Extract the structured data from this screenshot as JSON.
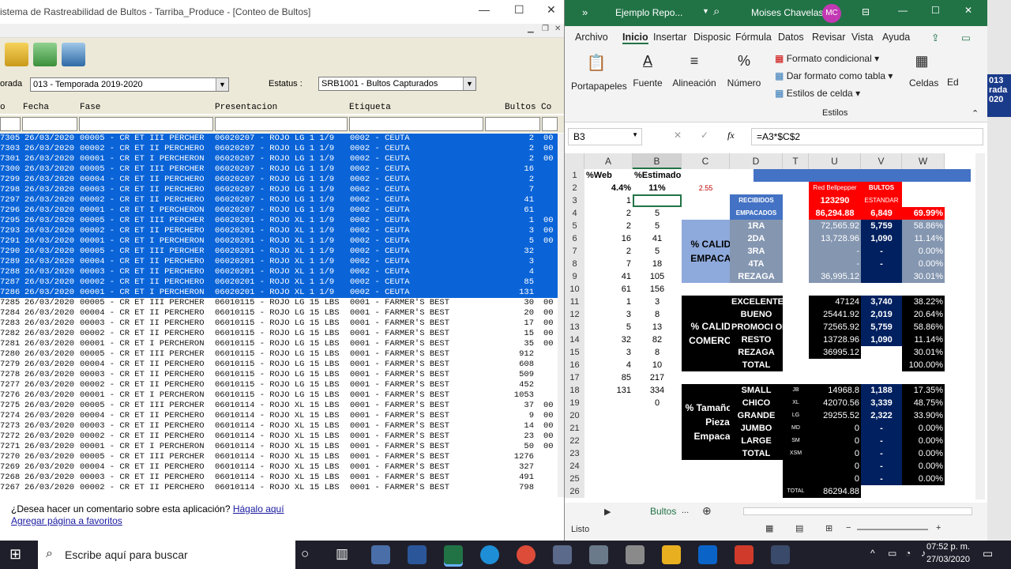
{
  "left_window": {
    "title": "istema de Rastreabilidad de Bultos - Tarriba_Produce - [Conteo de Bultos]",
    "temporada_label": "orada",
    "temporada_value": "013 - Temporada 2019-2020",
    "estatus_label": "Estatus :",
    "estatus_value": "SRB1001 - Bultos Capturados",
    "columns": [
      "o",
      "Fecha",
      "Fase",
      "Presentacion",
      "Etiqueta",
      "Bultos",
      "Co"
    ],
    "rows": [
      {
        "id": "7305",
        "date": "26/03/2020",
        "fase": "00005 - CR ET III PERCHER",
        "pres": "06020207 - ROJO LG 1 1/9",
        "etq": "0002 - CEUTA",
        "b": "2",
        "co": "00",
        "sel": true
      },
      {
        "id": "7303",
        "date": "26/03/2020",
        "fase": "00002 - CR ET II PERCHERO",
        "pres": "06020207 - ROJO LG 1 1/9",
        "etq": "0002 - CEUTA",
        "b": "2",
        "co": "00",
        "sel": true
      },
      {
        "id": "7301",
        "date": "26/03/2020",
        "fase": "00001 - CR ET I PERCHERON",
        "pres": "06020207 - ROJO LG 1 1/9",
        "etq": "0002 - CEUTA",
        "b": "2",
        "co": "00",
        "sel": true
      },
      {
        "id": "7300",
        "date": "26/03/2020",
        "fase": "00005 - CR ET III PERCHER",
        "pres": "06020207 - ROJO LG 1 1/9",
        "etq": "0002 - CEUTA",
        "b": "16",
        "co": "",
        "sel": true
      },
      {
        "id": "7299",
        "date": "26/03/2020",
        "fase": "00004 - CR ET II PERCHERO",
        "pres": "06020207 - ROJO LG 1 1/9",
        "etq": "0002 - CEUTA",
        "b": "2",
        "co": "",
        "sel": true
      },
      {
        "id": "7298",
        "date": "26/03/2020",
        "fase": "00003 - CR ET II PERCHERO",
        "pres": "06020207 - ROJO LG 1 1/9",
        "etq": "0002 - CEUTA",
        "b": "7",
        "co": "",
        "sel": true
      },
      {
        "id": "7297",
        "date": "26/03/2020",
        "fase": "00002 - CR ET II PERCHERO",
        "pres": "06020207 - ROJO LG 1 1/9",
        "etq": "0002 - CEUTA",
        "b": "41",
        "co": "",
        "sel": true
      },
      {
        "id": "7296",
        "date": "26/03/2020",
        "fase": "00001 - CR ET I PERCHERON",
        "pres": "06020207 - ROJO LG 1 1/9",
        "etq": "0002 - CEUTA",
        "b": "61",
        "co": "",
        "sel": true
      },
      {
        "id": "7295",
        "date": "26/03/2020",
        "fase": "00005 - CR ET III PERCHER",
        "pres": "06020201 - ROJO XL 1 1/9",
        "etq": "0002 - CEUTA",
        "b": "1",
        "co": "00",
        "sel": true
      },
      {
        "id": "7293",
        "date": "26/03/2020",
        "fase": "00002 - CR ET II PERCHERO",
        "pres": "06020201 - ROJO XL 1 1/9",
        "etq": "0002 - CEUTA",
        "b": "3",
        "co": "00",
        "sel": true
      },
      {
        "id": "7291",
        "date": "26/03/2020",
        "fase": "00001 - CR ET I PERCHERON",
        "pres": "06020201 - ROJO XL 1 1/9",
        "etq": "0002 - CEUTA",
        "b": "5",
        "co": "00",
        "sel": true
      },
      {
        "id": "7290",
        "date": "26/03/2020",
        "fase": "00005 - CR ET III PERCHER",
        "pres": "06020201 - ROJO XL 1 1/9",
        "etq": "0002 - CEUTA",
        "b": "32",
        "co": "",
        "sel": true
      },
      {
        "id": "7289",
        "date": "26/03/2020",
        "fase": "00004 - CR ET II PERCHERO",
        "pres": "06020201 - ROJO XL 1 1/9",
        "etq": "0002 - CEUTA",
        "b": "3",
        "co": "",
        "sel": true
      },
      {
        "id": "7288",
        "date": "26/03/2020",
        "fase": "00003 - CR ET II PERCHERO",
        "pres": "06020201 - ROJO XL 1 1/9",
        "etq": "0002 - CEUTA",
        "b": "4",
        "co": "",
        "sel": true
      },
      {
        "id": "7287",
        "date": "26/03/2020",
        "fase": "00002 - CR ET II PERCHERO",
        "pres": "06020201 - ROJO XL 1 1/9",
        "etq": "0002 - CEUTA",
        "b": "85",
        "co": "",
        "sel": true
      },
      {
        "id": "7286",
        "date": "26/03/2020",
        "fase": "00001 - CR ET I PERCHERON",
        "pres": "06020201 - ROJO XL 1 1/9",
        "etq": "0002 - CEUTA",
        "b": "131",
        "co": "",
        "sel": true
      },
      {
        "id": "7285",
        "date": "26/03/2020",
        "fase": "00005 - CR ET III PERCHER",
        "pres": "06010115 - ROJO LG 15 LBS",
        "etq": "0001 - FARMER'S BEST",
        "b": "30",
        "co": "00",
        "sel": false
      },
      {
        "id": "7284",
        "date": "26/03/2020",
        "fase": "00004 - CR ET II PERCHERO",
        "pres": "06010115 - ROJO LG 15 LBS",
        "etq": "0001 - FARMER'S BEST",
        "b": "20",
        "co": "00",
        "sel": false
      },
      {
        "id": "7283",
        "date": "26/03/2020",
        "fase": "00003 - CR ET II PERCHERO",
        "pres": "06010115 - ROJO LG 15 LBS",
        "etq": "0001 - FARMER'S BEST",
        "b": "17",
        "co": "00",
        "sel": false
      },
      {
        "id": "7282",
        "date": "26/03/2020",
        "fase": "00002 - CR ET II PERCHERO",
        "pres": "06010115 - ROJO LG 15 LBS",
        "etq": "0001 - FARMER'S BEST",
        "b": "15",
        "co": "00",
        "sel": false
      },
      {
        "id": "7281",
        "date": "26/03/2020",
        "fase": "00001 - CR ET I PERCHERON",
        "pres": "06010115 - ROJO LG 15 LBS",
        "etq": "0001 - FARMER'S BEST",
        "b": "35",
        "co": "00",
        "sel": false
      },
      {
        "id": "7280",
        "date": "26/03/2020",
        "fase": "00005 - CR ET III PERCHER",
        "pres": "06010115 - ROJO LG 15 LBS",
        "etq": "0001 - FARMER'S BEST",
        "b": "912",
        "co": "",
        "sel": false
      },
      {
        "id": "7279",
        "date": "26/03/2020",
        "fase": "00004 - CR ET II PERCHERO",
        "pres": "06010115 - ROJO LG 15 LBS",
        "etq": "0001 - FARMER'S BEST",
        "b": "608",
        "co": "",
        "sel": false
      },
      {
        "id": "7278",
        "date": "26/03/2020",
        "fase": "00003 - CR ET II PERCHERO",
        "pres": "06010115 - ROJO LG 15 LBS",
        "etq": "0001 - FARMER'S BEST",
        "b": "509",
        "co": "",
        "sel": false
      },
      {
        "id": "7277",
        "date": "26/03/2020",
        "fase": "00002 - CR ET II PERCHERO",
        "pres": "06010115 - ROJO LG 15 LBS",
        "etq": "0001 - FARMER'S BEST",
        "b": "452",
        "co": "",
        "sel": false
      },
      {
        "id": "7276",
        "date": "26/03/2020",
        "fase": "00001 - CR ET I PERCHERON",
        "pres": "06010115 - ROJO LG 15 LBS",
        "etq": "0001 - FARMER'S BEST",
        "b": "1053",
        "co": "",
        "sel": false
      },
      {
        "id": "7275",
        "date": "26/03/2020",
        "fase": "00005 - CR ET III PERCHER",
        "pres": "06010114 - ROJO XL 15 LBS",
        "etq": "0001 - FARMER'S BEST",
        "b": "37",
        "co": "00",
        "sel": false
      },
      {
        "id": "7274",
        "date": "26/03/2020",
        "fase": "00004 - CR ET II PERCHERO",
        "pres": "06010114 - ROJO XL 15 LBS",
        "etq": "0001 - FARMER'S BEST",
        "b": "9",
        "co": "00",
        "sel": false
      },
      {
        "id": "7273",
        "date": "26/03/2020",
        "fase": "00003 - CR ET II PERCHERO",
        "pres": "06010114 - ROJO XL 15 LBS",
        "etq": "0001 - FARMER'S BEST",
        "b": "14",
        "co": "00",
        "sel": false
      },
      {
        "id": "7272",
        "date": "26/03/2020",
        "fase": "00002 - CR ET II PERCHERO",
        "pres": "06010114 - ROJO XL 15 LBS",
        "etq": "0001 - FARMER'S BEST",
        "b": "23",
        "co": "00",
        "sel": false
      },
      {
        "id": "7271",
        "date": "26/03/2020",
        "fase": "00001 - CR ET I PERCHERON",
        "pres": "06010114 - ROJO XL 15 LBS",
        "etq": "0001 - FARMER'S BEST",
        "b": "50",
        "co": "00",
        "sel": false
      },
      {
        "id": "7270",
        "date": "26/03/2020",
        "fase": "00005 - CR ET III PERCHER",
        "pres": "06010114 - ROJO XL 15 LBS",
        "etq": "0001 - FARMER'S BEST",
        "b": "1276",
        "co": "",
        "sel": false
      },
      {
        "id": "7269",
        "date": "26/03/2020",
        "fase": "00004 - CR ET II PERCHERO",
        "pres": "06010114 - ROJO XL 15 LBS",
        "etq": "0001 - FARMER'S BEST",
        "b": "327",
        "co": "",
        "sel": false
      },
      {
        "id": "7268",
        "date": "26/03/2020",
        "fase": "00003 - CR ET II PERCHERO",
        "pres": "06010114 - ROJO XL 15 LBS",
        "etq": "0001 - FARMER'S BEST",
        "b": "491",
        "co": "",
        "sel": false
      },
      {
        "id": "7267",
        "date": "26/03/2020",
        "fase": "00002 - CR ET II PERCHERO",
        "pres": "06010114 - ROJO XL 15 LBS",
        "etq": "0001 - FARMER'S BEST",
        "b": "798",
        "co": "",
        "sel": false
      }
    ],
    "footer_text": "¿Desea hacer un comentario sobre esta aplicación?",
    "footer_link": "Hágalo aquí",
    "footer_fav": "Agregar página a favoritos"
  },
  "excel": {
    "file_name": "Ejemplo Repo...",
    "user_name": "Moises Chavelas",
    "user_initials": "MC",
    "tabs": [
      "Archivo",
      "Inicio",
      "Insertar",
      "Disposic",
      "Fórmula",
      "Datos",
      "Revisar",
      "Vista",
      "Ayuda"
    ],
    "ribbon": {
      "portapapeles": "Portapapeles",
      "fuente": "Fuente",
      "alineacion": "Alineación",
      "numero": "Número",
      "formato_condicional": "Formato condicional",
      "dar_formato": "Dar formato como tabla",
      "estilos_celda": "Estilos de celda",
      "estilos": "Estilos",
      "celdas": "Celdas",
      "ed": "Ed"
    },
    "name_box": "B3",
    "formula": "=A3*$C$2",
    "col_headers": [
      "A",
      "B",
      "C",
      "D",
      "T",
      "U",
      "V",
      "W"
    ],
    "row_numbers": [
      "1",
      "2",
      "3",
      "4",
      "5",
      "6",
      "7",
      "8",
      "9",
      "10",
      "11",
      "12",
      "13",
      "14",
      "15",
      "16",
      "17",
      "18",
      "19",
      "20",
      "21",
      "22",
      "23",
      "24",
      "25",
      "26"
    ],
    "colA": [
      "%Web",
      "4.4%",
      "1",
      "2",
      "2",
      "16",
      "2",
      "7",
      "41",
      "61",
      "1",
      "3",
      "5",
      "32",
      "3",
      "4",
      "85",
      "131",
      "",
      "",
      "",
      "",
      "",
      "",
      "",
      ""
    ],
    "colB": [
      "%Estimado",
      "11%",
      "",
      "5",
      "5",
      "41",
      "5",
      "18",
      "105",
      "156",
      "3",
      "8",
      "13",
      "82",
      "8",
      "10",
      "217",
      "334",
      "0",
      "",
      "",
      "",
      "",
      "",
      "",
      ""
    ],
    "c2": "2.55",
    "block1_label": "% CALIDAD EMPACADA",
    "block2_label": "% CALIDAD COMERCIAL",
    "block3_label": "% Tamaño por Pieza Empacada",
    "u2": "Red Bellpepper",
    "v2": "BULTOS",
    "d3": "RECIBIDOS",
    "u3": "123290",
    "v3": "ESTANDAR",
    "d4": "EMPACADOS",
    "u4": "86,294.88",
    "v4": "6,849",
    "w4": "69.99%",
    "quality_rows": [
      {
        "d": "1RA",
        "u": "72,565.92",
        "v": "5,759",
        "w": "58.86%"
      },
      {
        "d": "2DA",
        "u": "13,728.96",
        "v": "1,090",
        "w": "11.14%"
      },
      {
        "d": "3RA",
        "u": "-",
        "v": "-",
        "w": "0.00%"
      },
      {
        "d": "4TA",
        "u": "-",
        "v": "-",
        "w": "0.00%"
      },
      {
        "d": "REZAGA",
        "u": "36,995.12",
        "v": "",
        "w": "30.01%"
      }
    ],
    "commercial_rows": [
      {
        "d": "EXCELENTE",
        "u": "47124",
        "v": "3,740",
        "w": "38.22%"
      },
      {
        "d": "BUENO",
        "u": "25441.92",
        "v": "2,019",
        "w": "20.64%"
      },
      {
        "d": "PROMOCI ON",
        "u": "72565.92",
        "v": "5,759",
        "w": "58.86%"
      },
      {
        "d": "RESTO",
        "u": "13728.96",
        "v": "1,090",
        "w": "11.14%"
      },
      {
        "d": "REZAGA",
        "u": "36995.12",
        "v": "",
        "w": "30.01%"
      },
      {
        "d": "TOTAL",
        "u": "",
        "v": "",
        "w": "100.00%"
      }
    ],
    "size_rows": [
      {
        "d": "SMALL",
        "t": "JB",
        "u": "14968.8",
        "v": "1,188",
        "w": "17.35%"
      },
      {
        "d": "CHICO",
        "t": "XL",
        "u": "42070.56",
        "v": "3,339",
        "w": "48.75%"
      },
      {
        "d": "GRANDE",
        "t": "LG",
        "u": "29255.52",
        "v": "2,322",
        "w": "33.90%"
      },
      {
        "d": "JUMBO",
        "t": "MD",
        "u": "0",
        "v": "-",
        "w": "0.00%"
      },
      {
        "d": "LARGE",
        "t": "SM",
        "u": "0",
        "v": "-",
        "w": "0.00%"
      },
      {
        "d": "TOTAL",
        "t": "XSM",
        "u": "0",
        "v": "-",
        "w": "0.00%"
      },
      {
        "d": "",
        "t": "",
        "u": "0",
        "v": "-",
        "w": "0.00%"
      },
      {
        "d": "",
        "t": "",
        "u": "0",
        "v": "-",
        "w": "0.00%"
      },
      {
        "d": "",
        "t": "TOTAL",
        "u": "86294.88",
        "v": "",
        "w": ""
      }
    ],
    "sheet_tab": "Bultos",
    "status_ready": "Listo",
    "colors": {
      "green": "#217346",
      "blue": "#4472c4",
      "red": "#ff0000",
      "navy": "#002060",
      "lightblue": "#8ea9db",
      "black": "#000000"
    }
  },
  "right_edge": {
    "a": "013",
    "b": "rada",
    "c": "020"
  },
  "taskbar": {
    "search_placeholder": "Escribe aquí para buscar",
    "time": "07:52 p. m.",
    "date": "27/03/2020"
  }
}
